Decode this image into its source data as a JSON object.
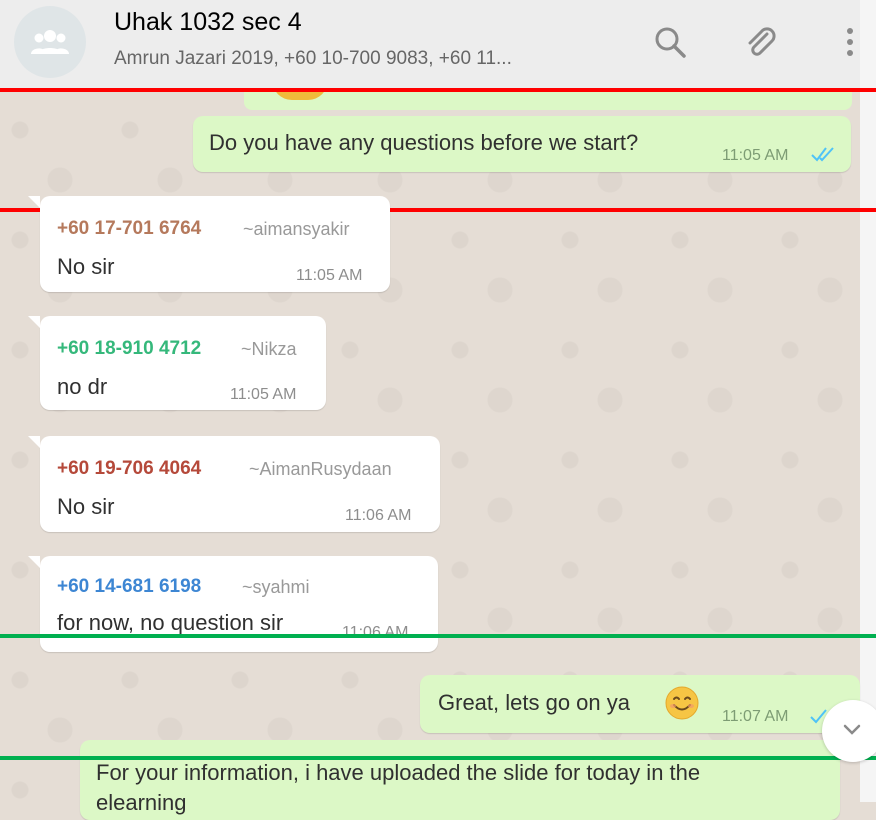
{
  "header": {
    "title": "Uhak 1032 sec 4",
    "subtitle": "Amrun Jazari 2019, +60 10-700 9083, +60 11..."
  },
  "icons": {
    "avatar": "group-icon",
    "search": "search-icon",
    "attach": "paperclip-icon",
    "menu": "more-vert-icon",
    "scroll": "chevron-down-icon",
    "ticks": "double-check-icon"
  },
  "colors": {
    "outgoing_bubble": "#dcf8c6",
    "incoming_bubble": "#ffffff",
    "read_ticks": "#4fc3f7",
    "highlight_red": "#ff0000",
    "highlight_green": "#00b050"
  },
  "messages": [
    {
      "direction": "out",
      "text": "Do you have any questions before we start?",
      "time": "11:05 AM",
      "status": "read"
    },
    {
      "direction": "in",
      "phone": "+60 17-701 6764",
      "name": "~aimansyakir",
      "phone_color": "#b5795c",
      "text": "No sir",
      "time": "11:05 AM"
    },
    {
      "direction": "in",
      "phone": "+60 18-910 4712",
      "name": "~Nikza",
      "phone_color": "#35b87b",
      "text": "no dr",
      "time": "11:05 AM"
    },
    {
      "direction": "in",
      "phone": "+60 19-706 4064",
      "name": "~AimanRusydaan",
      "phone_color": "#b5493a",
      "text": "No sir",
      "time": "11:06 AM"
    },
    {
      "direction": "in",
      "phone": "+60 14-681 6198",
      "name": "~syahmi",
      "phone_color": "#3d86d3",
      "text": "for now, no question sir",
      "time": "11:06 AM"
    },
    {
      "direction": "out",
      "text": "Great, lets go on ya",
      "time": "11:07 AM",
      "status": "sent"
    },
    {
      "direction": "out",
      "text": "For your information, i have uploaded the slide for today in the",
      "text2": "elearning",
      "time": ""
    }
  ]
}
